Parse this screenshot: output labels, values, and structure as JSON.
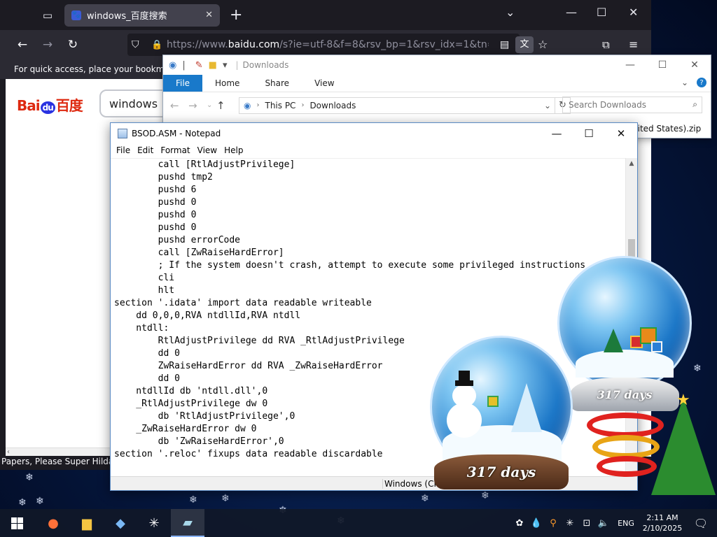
{
  "browser": {
    "tab_title": "windows_百度搜索",
    "url_domain": "baidu.com",
    "url_prefix": "https://www.",
    "url_rest": "/s?ie=utf-8&f=8&rsv_bp=1&rsv_idx=1&tn=baidu&w",
    "bookmarks_hint": "For quick access, place your bookmarks",
    "search_value": "windows",
    "baidu_logo": {
      "left": "Bai",
      "middle": "du",
      "right": "百度"
    },
    "status_text": "Papers, Please   Super Hilda"
  },
  "explorer": {
    "title": "Downloads",
    "ribbon_tabs": [
      "File",
      "Home",
      "Share",
      "View"
    ],
    "breadcrumb": [
      "This PC",
      "Downloads"
    ],
    "search_placeholder": "Search Downloads",
    "file_item": "nited States).zip"
  },
  "notepad": {
    "title": "BSOD.ASM - Notepad",
    "menu": [
      "File",
      "Edit",
      "Format",
      "View",
      "Help"
    ],
    "lines": [
      "        call [RtlAdjustPrivilege]",
      "        pushd tmp2",
      "        pushd 6",
      "        pushd 0",
      "        pushd 0",
      "        pushd 0",
      "        pushd errorCode",
      "        call [ZwRaiseHardError]",
      "        ; If the system doesn't crash, attempt to execute some privileged instructions",
      "        cli",
      "        hlt",
      "section '.idata' import data readable writeable",
      "    dd 0,0,0,RVA ntdllId,RVA ntdll",
      "    ntdll:",
      "        RtlAdjustPrivilege dd RVA _RtlAdjustPrivilege",
      "        dd 0",
      "        ZwRaiseHardError dd RVA _ZwRaiseHardError",
      "        dd 0",
      "    ntdllId db 'ntdll.dll',0",
      "    _RtlAdjustPrivilege dw 0",
      "        db 'RtlAdjustPrivilege',0",
      "    _ZwRaiseHardError dw 0",
      "        db 'ZwRaiseHardError',0",
      "section '.reloc' fixups data readable discardable"
    ],
    "status_encoding": "Windows (CRLF)"
  },
  "gadgets": {
    "globe_days_1": "317 days",
    "globe_days_2": "317 days"
  },
  "taskbar": {
    "lang": "ENG",
    "time": "2:11 AM",
    "date": "2/10/2025"
  }
}
